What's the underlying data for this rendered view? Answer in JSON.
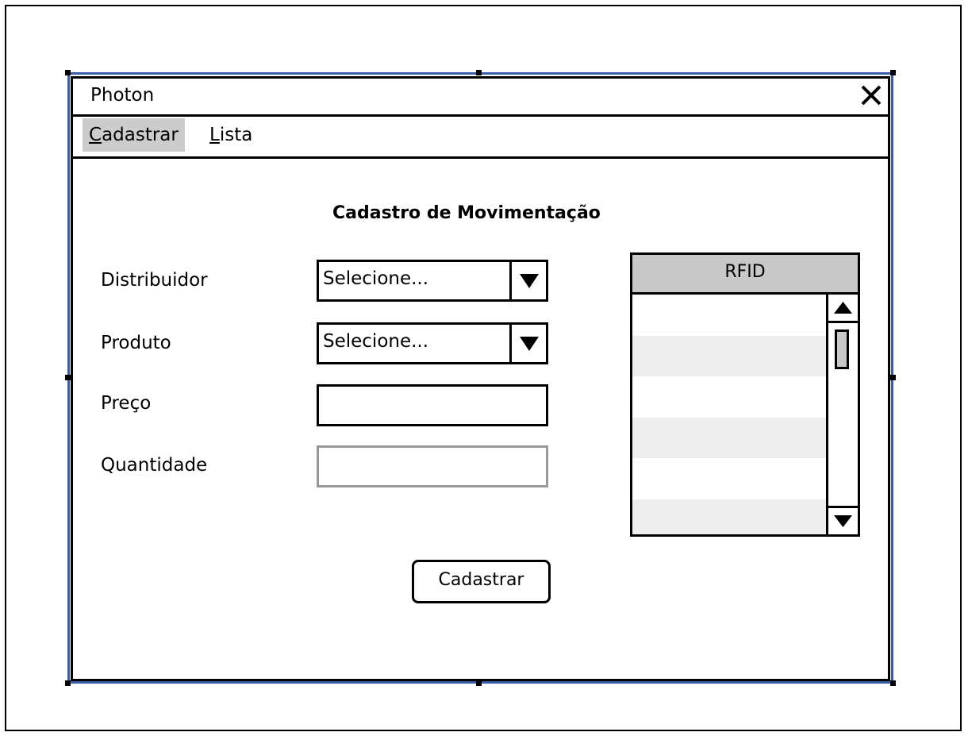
{
  "window": {
    "title": "Photon"
  },
  "menu": {
    "items": [
      {
        "mnemonic": "C",
        "rest": "adastrar",
        "active": true
      },
      {
        "mnemonic": "L",
        "rest": "ista",
        "active": false
      }
    ]
  },
  "form": {
    "title": "Cadastro de Movimentação",
    "fields": {
      "distribuidor": {
        "label": "Distribuidor",
        "value": "Selecione..."
      },
      "produto": {
        "label": "Produto",
        "value": "Selecione..."
      },
      "preco": {
        "label": "Preço",
        "value": ""
      },
      "quantidade": {
        "label": "Quantidade",
        "value": "",
        "disabled": true
      }
    },
    "submit_label": "Cadastrar"
  },
  "rfid_list": {
    "header": "RFID",
    "rows": [
      "",
      "",
      "",
      "",
      "",
      ""
    ]
  },
  "icons": {
    "close": "close-icon",
    "dropdown": "triangle-down-icon",
    "scroll_up": "triangle-up-icon",
    "scroll_down": "triangle-down-icon"
  },
  "colors": {
    "selection_border": "#3a5ea8",
    "active_menu": "#cccccc",
    "header_fill": "#c8c8c8",
    "alt_row": "#eeeeee",
    "disabled_border": "#999999"
  }
}
